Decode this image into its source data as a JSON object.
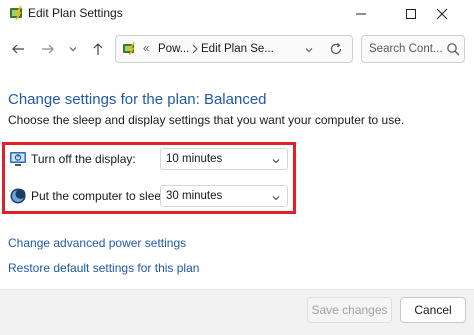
{
  "window": {
    "title": "Edit Plan Settings"
  },
  "address_bar": {
    "separator": "«",
    "segment_1": "Pow...",
    "segment_2": "Edit Plan Se..."
  },
  "search": {
    "placeholder": "Search Cont..."
  },
  "main": {
    "heading": "Change settings for the plan: Balanced",
    "description": "Choose the sleep and display settings that you want your computer to use.",
    "settings": [
      {
        "label": "Turn off the display:",
        "value": "10 minutes",
        "icon": "display-power-icon"
      },
      {
        "label": "Put the computer to sleep:",
        "value": "30 minutes",
        "icon": "sleep-moon-icon"
      }
    ],
    "links": {
      "advanced": "Change advanced power settings",
      "restore": "Restore default settings for this plan"
    }
  },
  "footer": {
    "save_label": "Save changes",
    "cancel_label": "Cancel"
  },
  "colors": {
    "accent_link": "#1e5aa8",
    "highlight_border": "#e0202a"
  }
}
